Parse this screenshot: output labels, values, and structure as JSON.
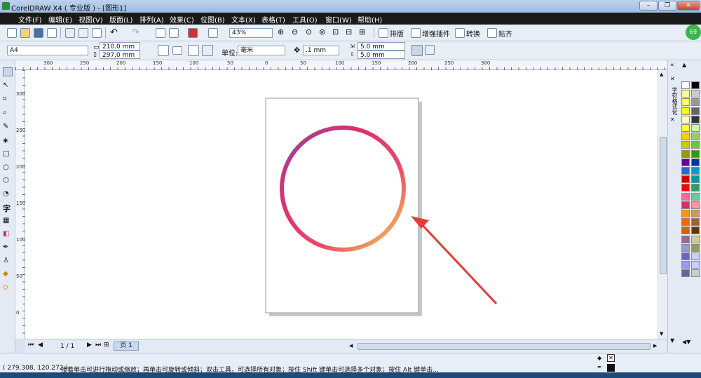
{
  "window": {
    "title": "CorelDRAW X4 ( 专业版 ) - [图形1]",
    "minimize": "–",
    "restore": "❐",
    "close": "✕"
  },
  "menu": [
    "文件(F)",
    "编辑(E)",
    "视图(V)",
    "版面(L)",
    "排列(A)",
    "效果(C)",
    "位图(B)",
    "文本(X)",
    "表格(T)",
    "工具(O)",
    "窗口(W)",
    "帮助(H)"
  ],
  "toolbar1": {
    "zoom": "43%",
    "btn_layout": "排版",
    "btn_plugins": "增强插件",
    "btn_convert": "转换",
    "btn_paste": "贴齐",
    "badge": "69"
  },
  "toolbar2": {
    "page_size": "A4",
    "width": "210.0 mm",
    "height": "297.0 mm",
    "unit_label": "单位:",
    "unit": "毫米",
    "nudge": ".1 mm",
    "dup_x": "5.0 mm",
    "dup_y": "5.0 mm"
  },
  "hruler_ticks": [
    "300",
    "250",
    "200",
    "150",
    "100",
    "50",
    "0",
    "50",
    "100",
    "150",
    "200",
    "250",
    "300"
  ],
  "vruler_ticks": [
    "300",
    "250",
    "200",
    "150",
    "100",
    "50",
    "0"
  ],
  "dock_label": "字符格式化",
  "pagenav": {
    "counter": "1 / 1",
    "tab": "页 1"
  },
  "status": {
    "coords": "( 279.308, 120.272 )",
    "message": "接着单击可进行拖动或缩放；再单击可旋转或倾斜；双击工具，可选择所有对象；按住 Shift 键单击可选择多个对象；按住 Alt 键单击..."
  },
  "colors": {
    "menubar": "#1a1a1a",
    "circle_gradient": [
      "#7f4f9f",
      "#e02d6e",
      "#f7d44a"
    ],
    "arrow": "#e43c32"
  },
  "palette_colors": [
    "#ffffff",
    "#000000",
    "#ffff99",
    "#cccccc",
    "#ffff66",
    "#999999",
    "#ffff00",
    "#666666",
    "#ffffcc",
    "#333333",
    "#ffff33",
    "#ccff99",
    "#ffcc00",
    "#99cc66",
    "#cccc00",
    "#66cc33",
    "#999900",
    "#339900",
    "#660099",
    "#003399",
    "#3366cc",
    "#0099cc",
    "#cc0000",
    "#009999",
    "#ff0000",
    "#339966",
    "#ff6699",
    "#66cc99",
    "#cc3366",
    "#ff9999",
    "#ff9900",
    "#cc9966",
    "#ff6600",
    "#996633",
    "#cc6600",
    "#663300",
    "#996699",
    "#cccc99",
    "#9999cc",
    "#999966",
    "#6666cc",
    "#ccccff",
    "#9999ff",
    "#ccccff",
    "#666699",
    "#cccccc"
  ]
}
